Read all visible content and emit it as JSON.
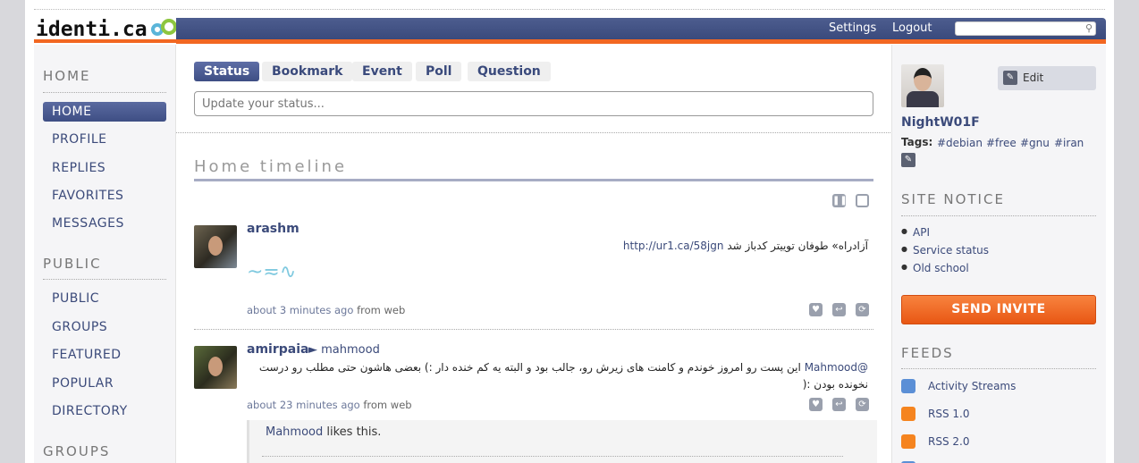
{
  "header": {
    "logo_text": "identi.ca",
    "nav": [
      {
        "label": "Settings"
      },
      {
        "label": "Logout"
      }
    ],
    "search_placeholder": ""
  },
  "left_nav": {
    "home_heading": "HOME",
    "home_items": [
      {
        "label": "HOME",
        "active": true
      },
      {
        "label": "PROFILE"
      },
      {
        "label": "REPLIES"
      },
      {
        "label": "FAVORITES"
      },
      {
        "label": "MESSAGES"
      }
    ],
    "public_heading": "PUBLIC",
    "public_items": [
      {
        "label": "PUBLIC"
      },
      {
        "label": "GROUPS"
      },
      {
        "label": "FEATURED"
      },
      {
        "label": "POPULAR"
      },
      {
        "label": "DIRECTORY"
      }
    ],
    "groups_heading": "GROUPS"
  },
  "notice_form": {
    "tabs": [
      {
        "label": "Status",
        "active": true
      },
      {
        "label": "Bookmark"
      },
      {
        "label": "Event"
      },
      {
        "label": "Poll"
      },
      {
        "label": "Question"
      }
    ],
    "status_placeholder": "Update your status..."
  },
  "timeline": {
    "title": "Home timeline",
    "notices": [
      {
        "nick": "arashm",
        "text_rtl": "آزادراه» طوفان توییتر کدباز شد",
        "link": "http://ur1.ca/58jgn",
        "time": "about 3 minutes ago",
        "source_prefix": "from",
        "source": "web"
      },
      {
        "nick": "amirpaia",
        "reply_to": "► mahmood",
        "mention": "@Mahmood",
        "text_rtl": "این پست رو امروز خوندم و کامنت های زیرش رو، جالب بود و البته یه کم خنده دار :) بعضی هاشون حتی مطلب رو درست نخونده بودن :(",
        "time": "about 23 minutes ago",
        "source_prefix": "from",
        "source": "web",
        "liked_by": "Mahmood",
        "likes_text": "likes this."
      }
    ]
  },
  "profile": {
    "nickname": "NightW01F",
    "edit_label": "Edit",
    "tags_label": "Tags:",
    "tags": [
      "#debian",
      "#free",
      "#gnu",
      "#iran"
    ]
  },
  "site_notice": {
    "heading": "SITE NOTICE",
    "links": [
      "API",
      "Service status",
      "Old school"
    ]
  },
  "invite": {
    "label": "SEND INVITE"
  },
  "feeds": {
    "heading": "FEEDS",
    "items": [
      {
        "label": "Activity Streams",
        "color": "#5b8fd6"
      },
      {
        "label": "RSS 1.0",
        "color": "#f5841f"
      },
      {
        "label": "RSS 2.0",
        "color": "#f5841f"
      }
    ]
  }
}
